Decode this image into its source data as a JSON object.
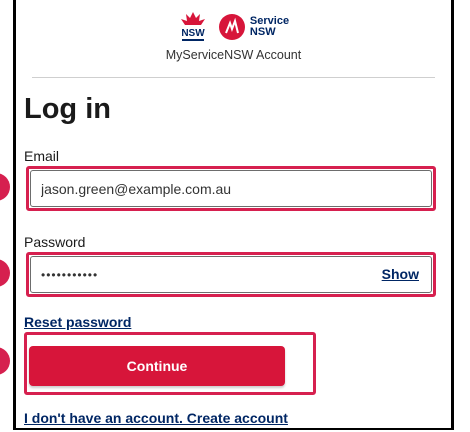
{
  "header": {
    "nsw_logo_text": "NSW",
    "service_logo_line1": "Service",
    "service_logo_line2": "NSW",
    "subtitle": "MyServiceNSW Account"
  },
  "form": {
    "title": "Log in",
    "email_label": "Email",
    "email_value": "jason.green@example.com.au",
    "password_label": "Password",
    "password_value": "•••••••••••",
    "show_label": "Show",
    "reset_label": "Reset password",
    "continue_label": "Continue",
    "create_account_label": "I don't have an account. Create account"
  },
  "colors": {
    "brand_red": "#d7153a",
    "brand_navy": "#002664",
    "highlight": "#d6204f"
  }
}
